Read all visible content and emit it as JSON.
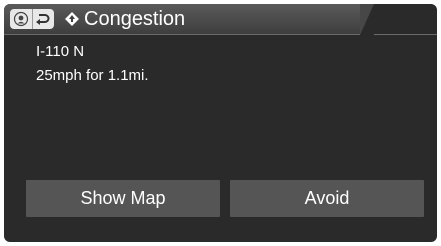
{
  "header": {
    "title": "Congestion",
    "icons": [
      "voice-command-icon",
      "back-icon",
      "traffic-icon"
    ]
  },
  "info": {
    "road": "I-110 N",
    "detail": "25mph for 1.1mi."
  },
  "buttons": {
    "show_map": "Show Map",
    "avoid": "Avoid"
  },
  "colors": {
    "background": "#2a2a2a",
    "header": "#474747",
    "button": "#555555",
    "text": "#ffffff"
  }
}
